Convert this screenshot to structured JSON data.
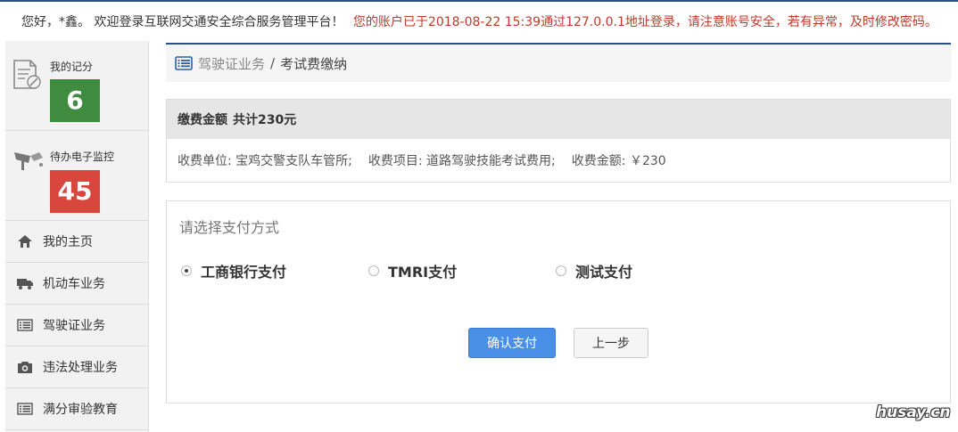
{
  "header": {
    "greeting": "您好，*鑫。 欢迎登录互联网交通安全综合服务管理平台！",
    "warning": "您的账户已于2018-08-22 15:39通过127.0.0.1地址登录，请注意账号安全，若有异常，及时修改密码。"
  },
  "sidebar": {
    "score": {
      "label": "我的记分",
      "value": "6",
      "color": "#3f8b3f"
    },
    "monitor": {
      "label": "待办电子监控",
      "value": "45",
      "color": "#d9463d"
    },
    "items": [
      {
        "label": "我的主页",
        "icon": "home-icon"
      },
      {
        "label": "机动车业务",
        "icon": "truck-icon"
      },
      {
        "label": "驾驶证业务",
        "icon": "list-icon"
      },
      {
        "label": "违法处理业务",
        "icon": "camera-icon"
      },
      {
        "label": "满分审验教育",
        "icon": "list-icon"
      }
    ]
  },
  "breadcrumb": {
    "parent": "驾驶证业务",
    "separator": "/",
    "current": "考试费缴纳"
  },
  "fee": {
    "title": "缴费金额",
    "total": "共计230元",
    "unit": "收费单位: 宝鸡交警支队车管所;",
    "item": "收费项目: 道路驾驶技能考试费用;",
    "amount": "收费金额: ￥230"
  },
  "payment": {
    "title": "请选择支付方式",
    "options": [
      {
        "label": "工商银行支付",
        "checked": true
      },
      {
        "label": "TMRI支付",
        "checked": false
      },
      {
        "label": "测试支付",
        "checked": false
      }
    ],
    "confirm_label": "确认支付",
    "back_label": "上一步"
  },
  "watermark": "husay.cn",
  "colors": {
    "accent": "#2b4f8f",
    "primary_button": "#4a8fe7",
    "warning_text": "#c0392b"
  }
}
